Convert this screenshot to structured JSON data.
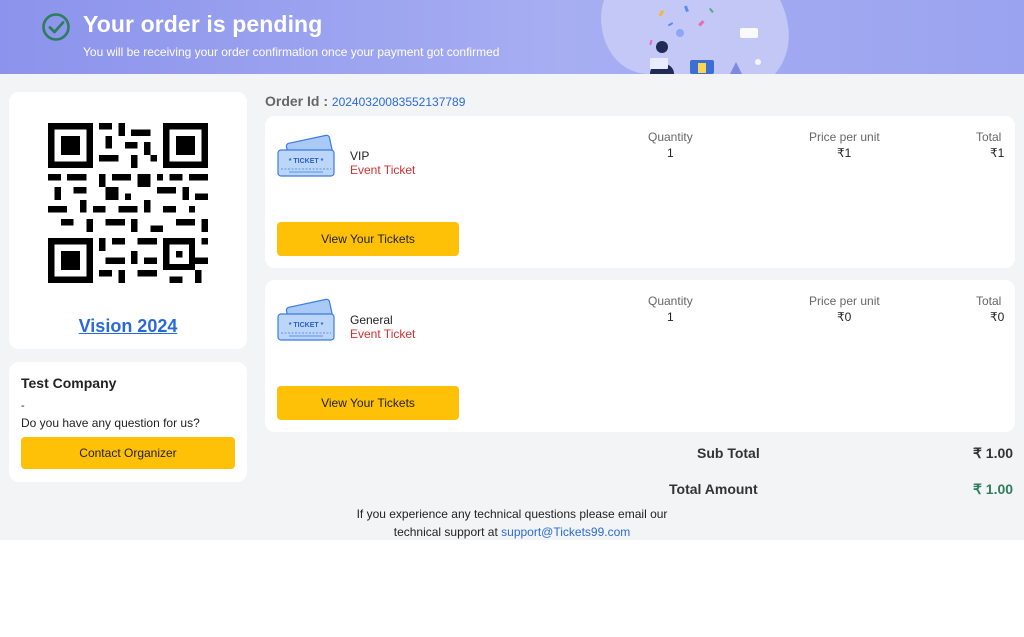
{
  "banner": {
    "title": "Your order is pending",
    "subtitle": "You will be receiving your order confirmation once your payment got confirmed",
    "check_icon": "check-circle-icon",
    "illustration": "person-with-laptop-illustration"
  },
  "event": {
    "qr_icon": "qr-code",
    "name": "Vision 2024"
  },
  "organizer": {
    "name": "Test Company",
    "detail": "-",
    "question": "Do you have any question for us?",
    "contact_label": "Contact Organizer"
  },
  "order": {
    "id_label": "Order Id :",
    "id_value": "20240320083552137789"
  },
  "columns": {
    "quantity": "Quantity",
    "price": "Price per unit",
    "total": "Total"
  },
  "tickets": [
    {
      "name": "VIP",
      "type": "Event Ticket",
      "quantity": "1",
      "price": "₹1",
      "total": "₹1",
      "button": "View Your Tickets",
      "icon": "ticket-icon"
    },
    {
      "name": "General",
      "type": "Event Ticket",
      "quantity": "1",
      "price": "₹0",
      "total": "₹0",
      "button": "View Your Tickets",
      "icon": "ticket-icon"
    }
  ],
  "summary": {
    "subtotal_label": "Sub Total",
    "subtotal_value": "₹ 1.00",
    "total_label": "Total Amount",
    "total_value": "₹ 1.00"
  },
  "support": {
    "line1": "If you experience any technical questions please email our",
    "line2_prefix": "technical support at ",
    "email": "support@Tickets99.com"
  },
  "colors": {
    "accent": "#ffc107",
    "link": "#2a6ad8",
    "danger": "#d32f2f",
    "total_green": "#2e7d5b",
    "banner": "#9aa3f0"
  }
}
